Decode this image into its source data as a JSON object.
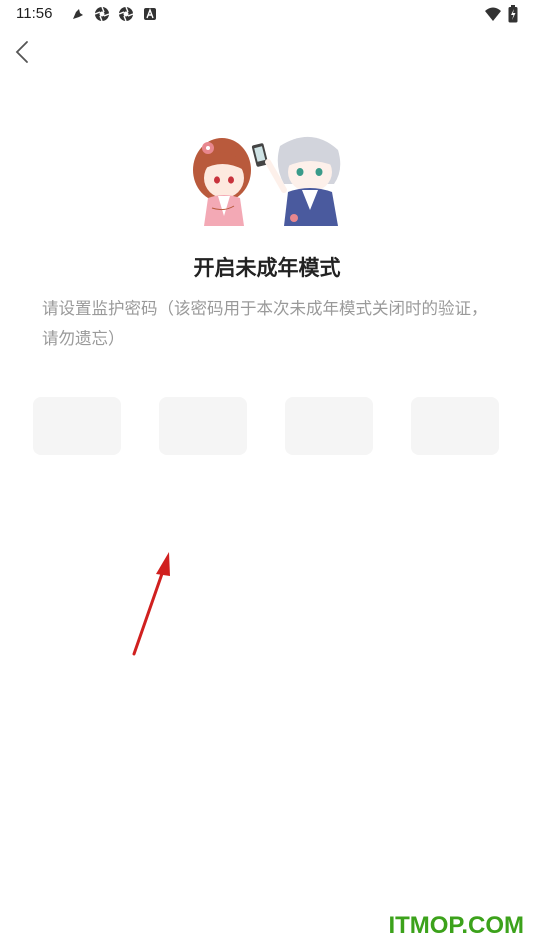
{
  "status_bar": {
    "time": "11:56",
    "left_icons": [
      "bird-icon",
      "aperture-icon",
      "aperture-icon",
      "a-badge-icon"
    ],
    "right_icons": [
      "wifi-icon",
      "battery-charging-icon"
    ]
  },
  "header": {
    "back_icon": "chevron-left-icon"
  },
  "main": {
    "title": "开启未成年模式",
    "instruction": "请设置监护密码（该密码用于本次未成年模式关闭时的验证，请勿遗忘）",
    "pin_boxes": [
      "",
      "",
      "",
      ""
    ]
  },
  "overlay": {
    "arrow_color": "#d0201f"
  },
  "watermark": {
    "text": "ITMOP.COM",
    "color": "#3ca21b"
  }
}
